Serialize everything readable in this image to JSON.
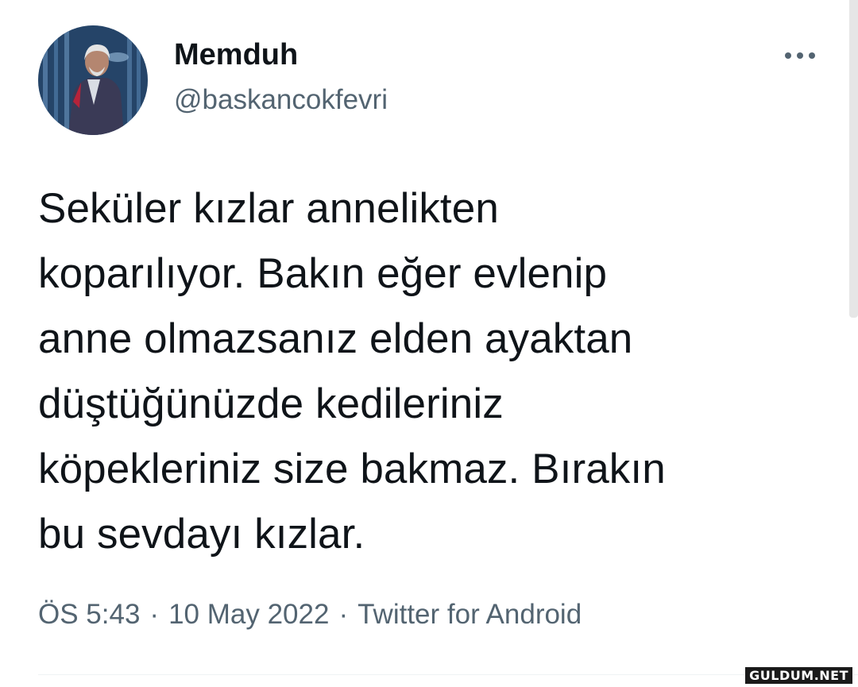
{
  "user": {
    "display_name": "Memduh",
    "handle": "@baskancokfevri"
  },
  "tweet": {
    "text": "Seküler kızlar annelikten\nkoparılıyor. Bakın eğer evlenip\nanne olmazsanız elden ayaktan\ndüştüğünüzde kedileriniz\nköpekleriniz size bakmaz. Bırakın\nbu sevdayı kızlar.",
    "time": "ÖS 5:43",
    "separator": "·",
    "date": "10 May 2022",
    "source": "Twitter for Android"
  },
  "icons": {
    "avatar": "profile-photo",
    "more": "more-horizontal-icon"
  },
  "watermark": "GULDUM.NET",
  "colors": {
    "text_primary": "#0f1419",
    "text_secondary": "#536471",
    "divider": "#eff3f4"
  }
}
